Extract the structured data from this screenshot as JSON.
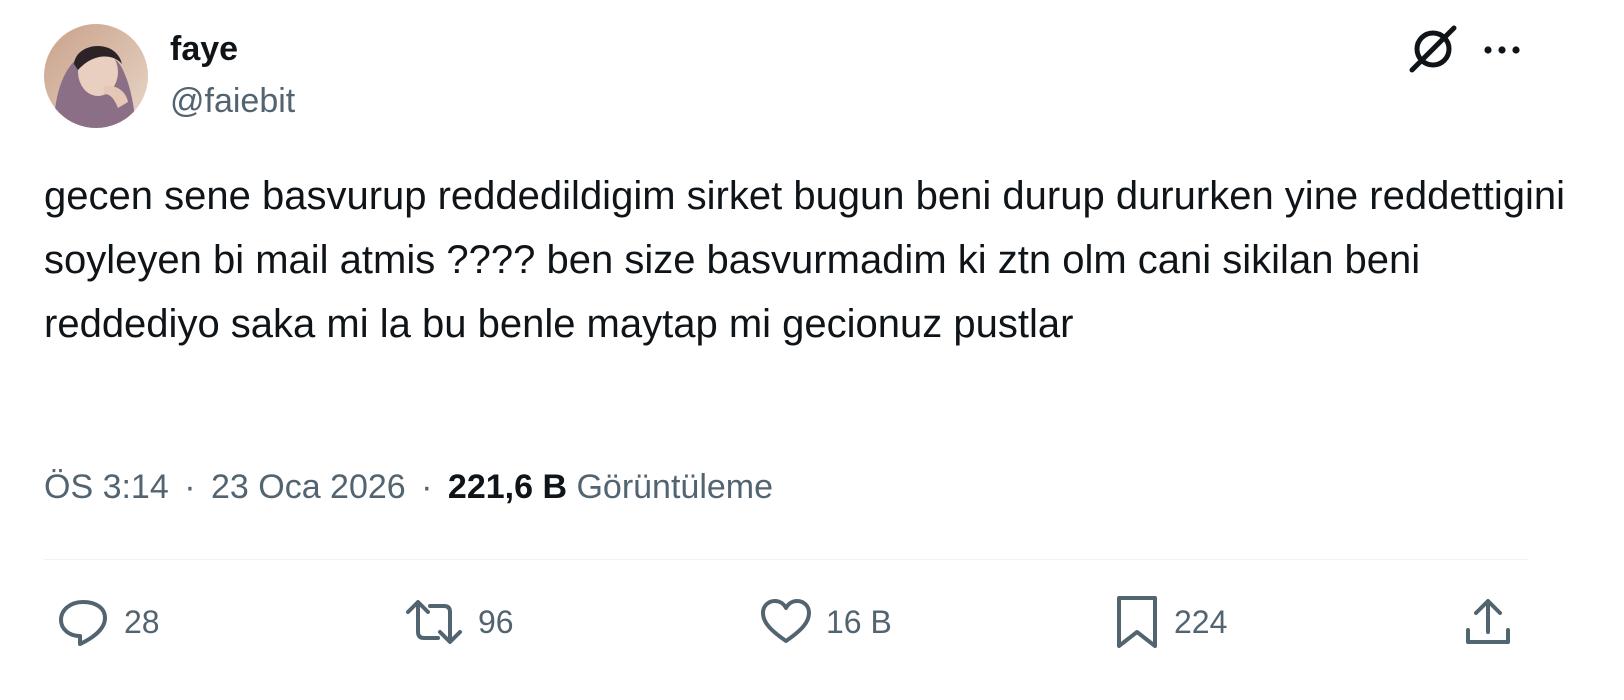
{
  "author": {
    "display_name": "faye",
    "handle": "@faiebit"
  },
  "tweet": {
    "text": "gecen sene basvurup reddedildigim sirket bugun beni durup dururken yine reddettigini soyleyen bi mail atmis ???? ben size basvurmadim ki ztn olm cani sikilan beni reddediyo saka mi la bu benle maytap mi gecionuz pustlar",
    "time": "ÖS 3:14",
    "date": "23 Oca 2026",
    "separator": "·",
    "views_count": "221,6 B",
    "views_label": "Görüntüleme"
  },
  "actions": {
    "replies": "28",
    "retweets": "96",
    "likes": "16 B",
    "bookmarks": "224"
  },
  "icons": {
    "grok": "grok-icon",
    "more": "more-icon",
    "reply": "reply-icon",
    "retweet": "retweet-icon",
    "like": "heart-icon",
    "bookmark": "bookmark-icon",
    "share": "share-icon"
  },
  "colors": {
    "primary_text": "#0f1419",
    "secondary_text": "#536471",
    "divider": "#eff3f4"
  }
}
